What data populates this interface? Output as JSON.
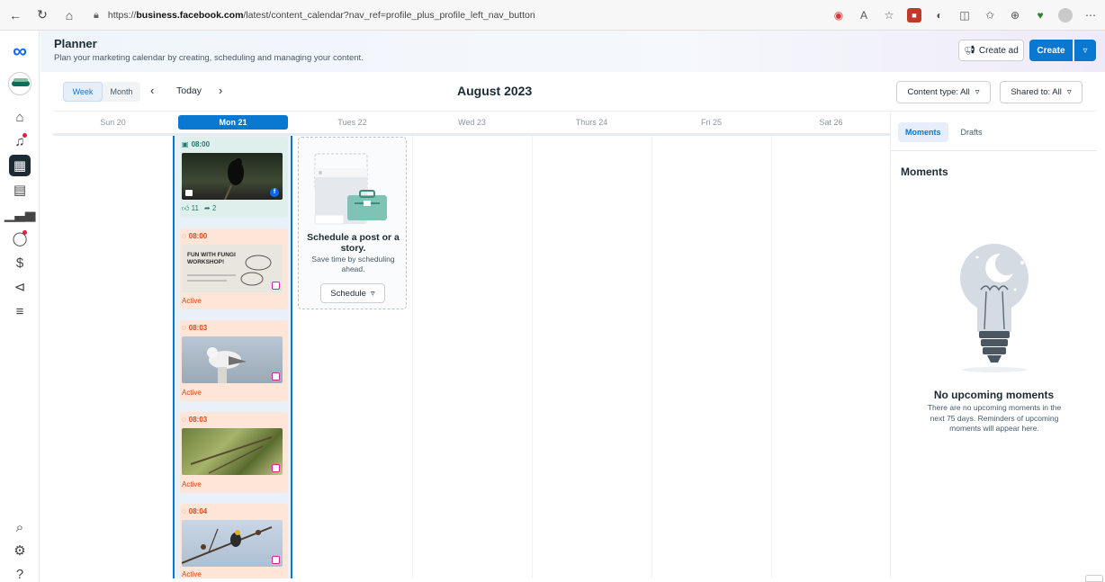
{
  "browser": {
    "url_prefix": "https://",
    "url_host": "business.facebook.com",
    "url_path": "/latest/content_calendar?nav_ref=profile_plus_profile_left_nav_button"
  },
  "header": {
    "title": "Planner",
    "subtitle": "Plan your marketing calendar by creating, scheduling and managing your content.",
    "create_ad_label": "Create ad",
    "create_label": "Create"
  },
  "toolbar": {
    "week_label": "Week",
    "month_label": "Month",
    "today_label": "Today",
    "month_title": "August 2023",
    "content_type_label": "Content type: All",
    "shared_to_label": "Shared to: All"
  },
  "days": [
    "Sun 20",
    "Mon 21",
    "Tues 22",
    "Wed 23",
    "Thurs 24",
    "Fri 25",
    "Sat 26"
  ],
  "posts": [
    {
      "time": "08:00",
      "kind": "published",
      "platform": "facebook",
      "likes": "11",
      "shares": "2"
    },
    {
      "time": "08:00",
      "kind": "scheduled",
      "platform": "instagram",
      "status": "Active",
      "image_text": "FUN WITH FUNGI WORKSHOP!"
    },
    {
      "time": "08:03",
      "kind": "scheduled",
      "platform": "instagram",
      "status": "Active"
    },
    {
      "time": "08:03",
      "kind": "scheduled",
      "platform": "instagram",
      "status": "Active"
    },
    {
      "time": "08:04",
      "kind": "scheduled",
      "platform": "instagram",
      "status": "Active"
    }
  ],
  "schedule_prompt": {
    "title": "Schedule a post or a story.",
    "subtitle": "Save time by scheduling ahead.",
    "button_label": "Schedule"
  },
  "right_panel": {
    "tab_moments": "Moments",
    "tab_drafts": "Drafts",
    "title": "Moments",
    "empty_title": "No upcoming moments",
    "empty_text": "There are no upcoming moments in the next 75 days. Reminders of upcoming moments will appear here."
  },
  "colors": {
    "brand_blue": "#0a78d1",
    "published_bg": "#dff0ec",
    "scheduled_bg": "#fde6d8",
    "status_orange": "#d4491d"
  },
  "icons": {
    "left_nav": [
      "home-icon",
      "notifications-icon",
      "planner-icon",
      "content-icon",
      "insights-icon",
      "instagram-activity-icon",
      "monetization-icon",
      "ads-icon",
      "menu-icon",
      "search-icon",
      "settings-icon",
      "help-icon"
    ]
  }
}
